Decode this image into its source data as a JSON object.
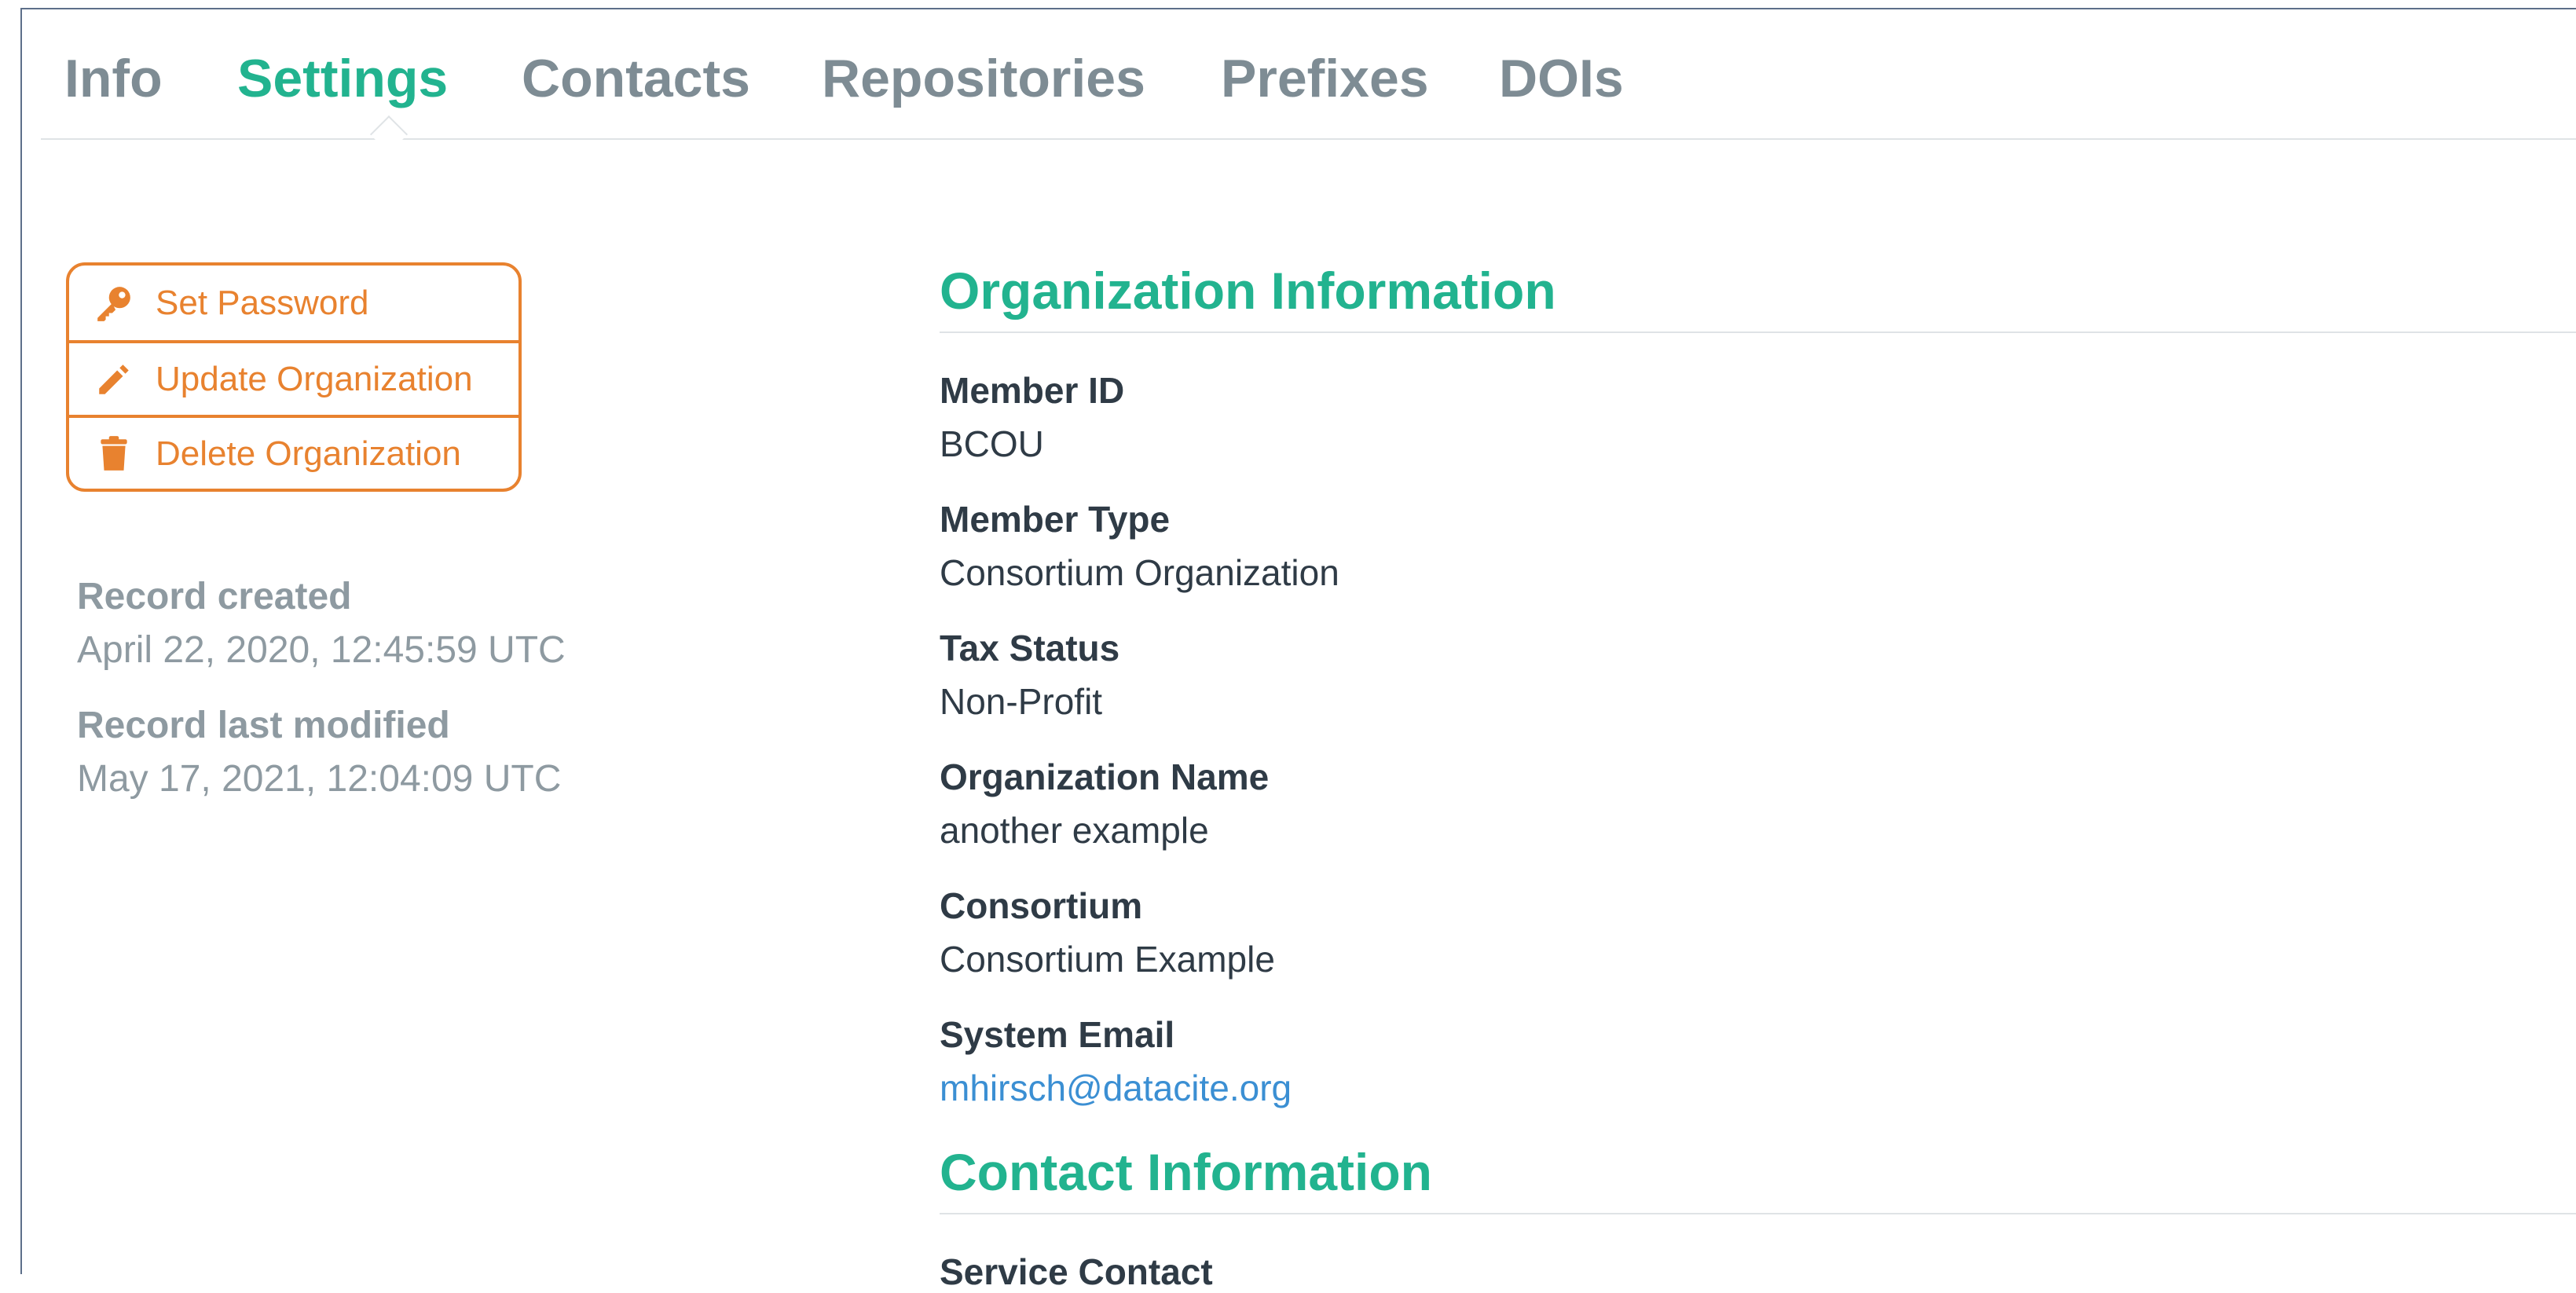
{
  "tabs": [
    {
      "label": "Info",
      "active": false
    },
    {
      "label": "Settings",
      "active": true
    },
    {
      "label": "Contacts",
      "active": false
    },
    {
      "label": "Repositories",
      "active": false
    },
    {
      "label": "Prefixes",
      "active": false
    },
    {
      "label": "DOIs",
      "active": false
    }
  ],
  "actions": {
    "set_password": "Set Password",
    "update_organization": "Update Organization",
    "delete_organization": "Delete Organization"
  },
  "record": {
    "created_label": "Record created",
    "created_value": "April 22, 2020, 12:45:59 UTC",
    "modified_label": "Record last modified",
    "modified_value": "May 17, 2021, 12:04:09 UTC"
  },
  "organization_info": {
    "title": "Organization Information",
    "fields": [
      {
        "label": "Member ID",
        "value": "BCOU"
      },
      {
        "label": "Member Type",
        "value": "Consortium Organization"
      },
      {
        "label": "Tax Status",
        "value": "Non-Profit"
      },
      {
        "label": "Organization Name",
        "value": "another example"
      },
      {
        "label": "Consortium",
        "value": "Consortium Example"
      },
      {
        "label": "System Email",
        "value": "mhirsch@datacite.org"
      }
    ]
  },
  "contact_info": {
    "title": "Contact Information",
    "first_label": "Service Contact"
  },
  "colors": {
    "accent": "#22b38f",
    "action": "#e8822f",
    "link": "#3b8fd3",
    "muted": "#8e9aa1",
    "text": "#2f3b46"
  }
}
